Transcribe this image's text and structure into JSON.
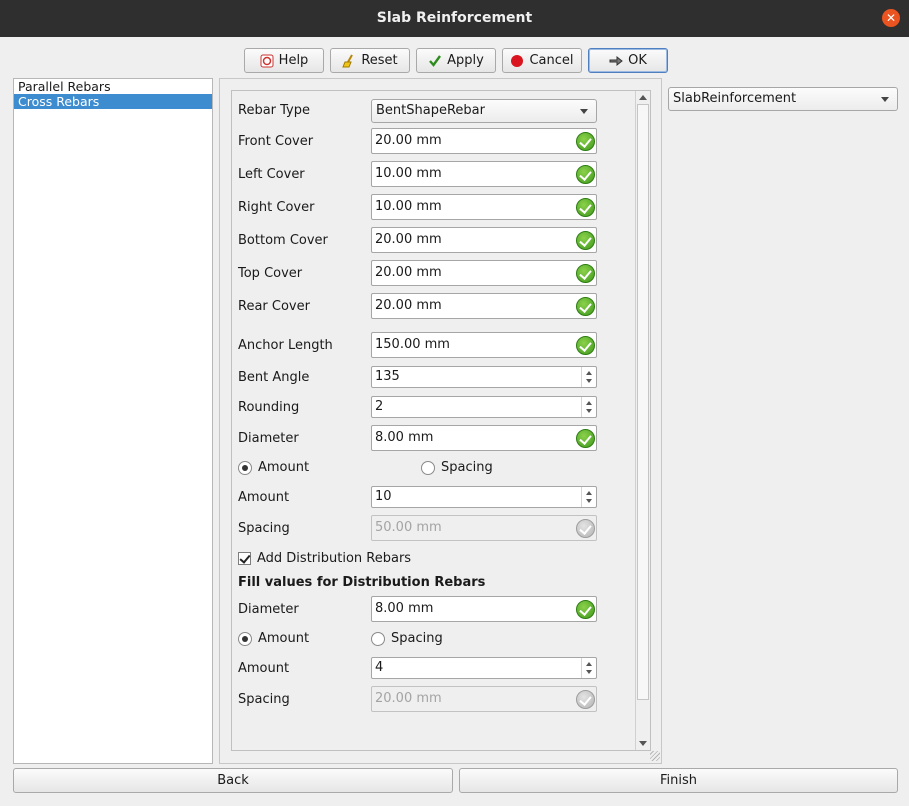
{
  "window": {
    "title": "Slab Reinforcement",
    "close_glyph": "✕"
  },
  "toolbar": {
    "help": "Help",
    "reset": "Reset",
    "apply": "Apply",
    "cancel": "Cancel",
    "ok": "OK"
  },
  "sidebar": {
    "items": [
      {
        "label": "Parallel Rebars"
      },
      {
        "label": "Cross Rebars",
        "selected": true
      }
    ]
  },
  "object_selector": {
    "value": "SlabReinforcement"
  },
  "form": {
    "rebar_type": {
      "label": "Rebar Type",
      "value": "BentShapeRebar"
    },
    "front_cover": {
      "label": "Front Cover",
      "value": "20.00 mm"
    },
    "left_cover": {
      "label": "Left Cover",
      "value": "10.00 mm"
    },
    "right_cover": {
      "label": "Right Cover",
      "value": "10.00 mm"
    },
    "bottom_cover": {
      "label": "Bottom Cover",
      "value": "20.00 mm"
    },
    "top_cover": {
      "label": "Top Cover",
      "value": "20.00 mm"
    },
    "rear_cover": {
      "label": "Rear Cover",
      "value": "20.00 mm"
    },
    "anchor_length": {
      "label": "Anchor Length",
      "value": "150.00 mm"
    },
    "bent_angle": {
      "label": "Bent Angle",
      "value": "135"
    },
    "rounding": {
      "label": "Rounding",
      "value": "2"
    },
    "diameter": {
      "label": "Diameter",
      "value": "8.00 mm"
    },
    "mode": {
      "amount_label": "Amount",
      "spacing_label": "Spacing",
      "selected": "Amount"
    },
    "amount": {
      "label": "Amount",
      "value": "10"
    },
    "spacing": {
      "label": "Spacing",
      "value": "50.00 mm",
      "disabled": true
    },
    "add_distribution": {
      "label": "Add Distribution Rebars",
      "checked": true
    },
    "distribution": {
      "title": "Fill values for Distribution Rebars",
      "diameter": {
        "label": "Diameter",
        "value": "8.00 mm"
      },
      "mode": {
        "amount_label": "Amount",
        "spacing_label": "Spacing",
        "selected": "Amount"
      },
      "amount": {
        "label": "Amount",
        "value": "4"
      },
      "spacing": {
        "label": "Spacing",
        "value": "20.00 mm",
        "disabled": true
      }
    }
  },
  "footer": {
    "back": "Back",
    "finish": "Finish"
  },
  "colors": {
    "titlebar": "#2f2f2f",
    "selection": "#3d8ccf",
    "close": "#e95420",
    "valid": "#4caf2a"
  }
}
